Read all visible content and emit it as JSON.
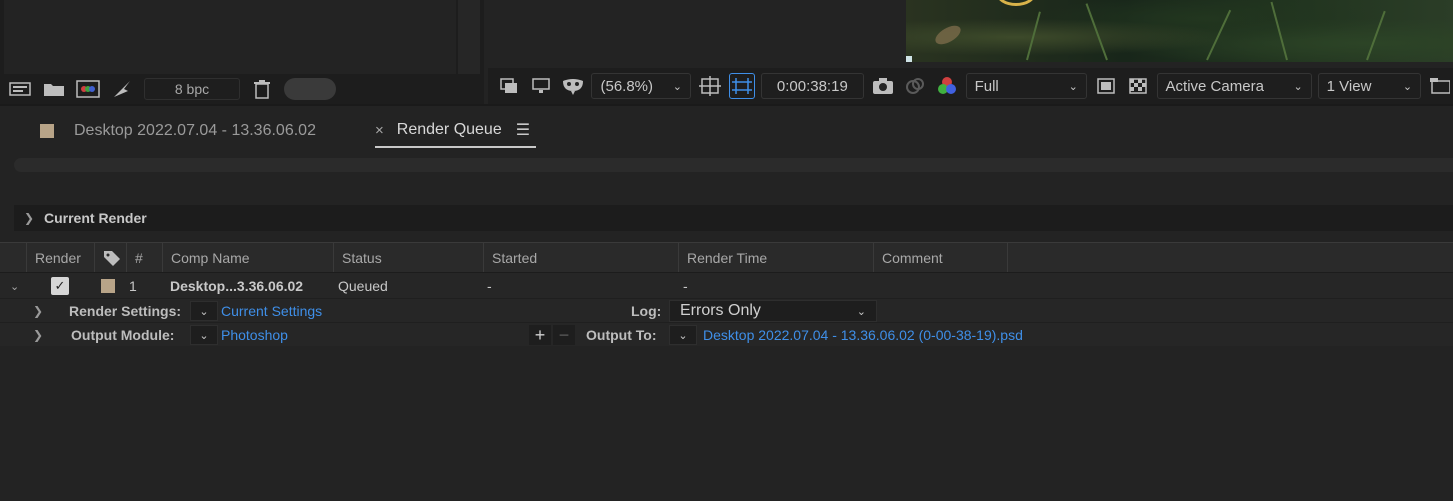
{
  "project_footer": {
    "bpc": "8 bpc"
  },
  "viewer_toolbar": {
    "zoom": "(56.8%)",
    "timecode": "0:00:38:19",
    "resolution": "Full",
    "camera": "Active Camera",
    "views": "1 View"
  },
  "tabs": [
    {
      "label": "Desktop 2022.07.04 - 13.36.06.02",
      "color": "#b8a488"
    },
    {
      "label": "Render Queue",
      "close": "×"
    }
  ],
  "current_render": {
    "label": "Current Render"
  },
  "table": {
    "headers": [
      "Render",
      "#",
      "Comp Name",
      "Status",
      "Started",
      "Render Time",
      "Comment"
    ],
    "row": {
      "checked": "✓",
      "number": "1",
      "comp_name": "Desktop...3.36.06.02",
      "status": "Queued",
      "started": "-",
      "render_time": "-",
      "label_color": "#b8a488"
    },
    "render_settings_label": "Render Settings:",
    "render_settings_value": "Current Settings",
    "log_label": "Log:",
    "log_value": "Errors Only",
    "output_module_label": "Output Module:",
    "output_module_value": "Photoshop",
    "output_to_label": "Output To:",
    "output_to_value": "Desktop 2022.07.04 - 13.36.06.02 (0-00-38-19).psd"
  },
  "colors": {
    "link": "#3f8fe8",
    "accent_tab": "#c8c8c8"
  }
}
